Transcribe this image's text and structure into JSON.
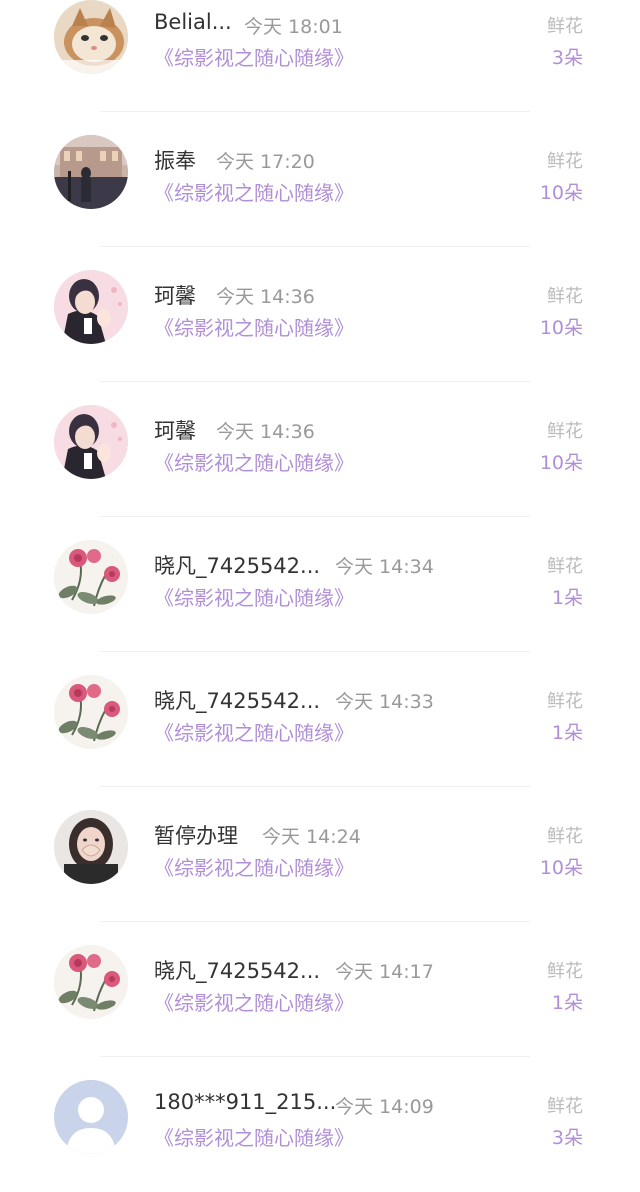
{
  "gift_records": [
    {
      "user": "Belial...",
      "time": "今天 18:01",
      "book": "《综影视之随心随缘》",
      "gift_label": "鲜花",
      "gift_count": "3朵",
      "avatar": "cat-avatar"
    },
    {
      "user": "振奉",
      "time": "今天 17:20",
      "book": "《综影视之随心随缘》",
      "gift_label": "鲜花",
      "gift_count": "10朵",
      "avatar": "street-photo-avatar"
    },
    {
      "user": "珂馨",
      "time": "今天 14:36",
      "book": "《综影视之随心随缘》",
      "gift_label": "鲜花",
      "gift_count": "10朵",
      "avatar": "anime-couple-avatar"
    },
    {
      "user": "珂馨",
      "time": "今天 14:36",
      "book": "《综影视之随心随缘》",
      "gift_label": "鲜花",
      "gift_count": "10朵",
      "avatar": "anime-couple-avatar"
    },
    {
      "user": "晓凡_7425542...",
      "time": "今天 14:34",
      "book": "《综影视之随心随缘》",
      "gift_label": "鲜花",
      "gift_count": "1朵",
      "avatar": "peony-painting-avatar"
    },
    {
      "user": "晓凡_7425542...",
      "time": "今天 14:33",
      "book": "《综影视之随心随缘》",
      "gift_label": "鲜花",
      "gift_count": "1朵",
      "avatar": "peony-painting-avatar"
    },
    {
      "user": "暂停办理",
      "time": "今天 14:24",
      "book": "《综影视之随心随缘》",
      "gift_label": "鲜花",
      "gift_count": "10朵",
      "avatar": "girl-heart-hands-avatar"
    },
    {
      "user": "晓凡_7425542...",
      "time": "今天 14:17",
      "book": "《综影视之随心随缘》",
      "gift_label": "鲜花",
      "gift_count": "1朵",
      "avatar": "peony-painting-avatar"
    },
    {
      "user": "180***911_215...",
      "time": "今天 14:09",
      "book": "《综影视之随心随缘》",
      "gift_label": "鲜花",
      "gift_count": "3朵",
      "avatar": "default-user-avatar"
    }
  ],
  "colors": {
    "accent": "#b08fd6",
    "name": "#333333",
    "muted": "#999999",
    "label": "#bbbbbb"
  }
}
